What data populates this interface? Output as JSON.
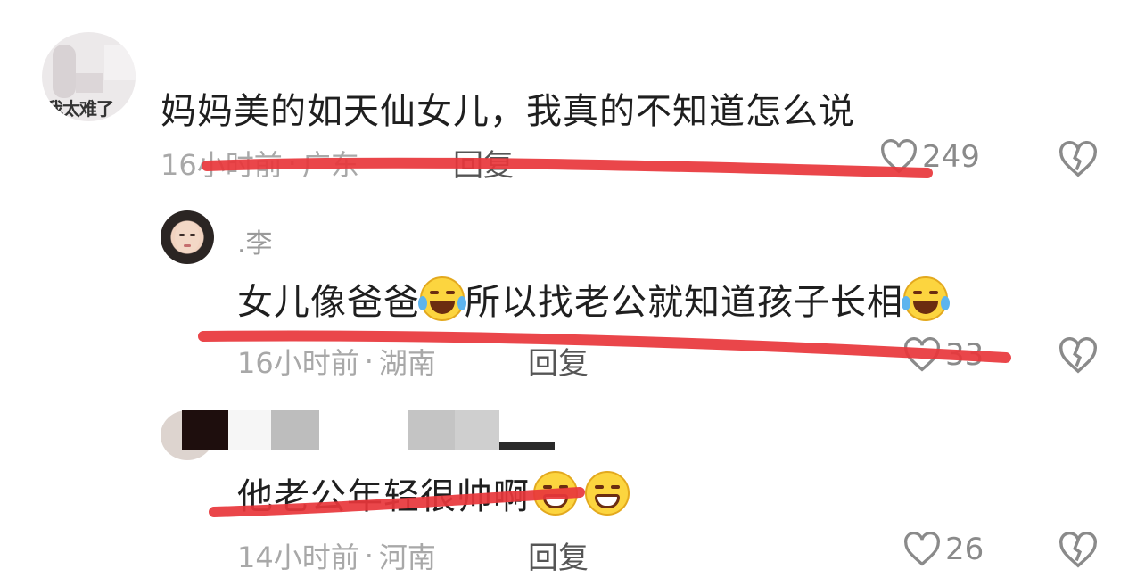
{
  "comments": [
    {
      "avatar_text": "我太难了",
      "text": "妈妈美的如天仙女儿，我真的不知道怎么说",
      "meta": {
        "time": "16小时前",
        "location": "广东",
        "reply": "回复"
      },
      "likes": "249"
    },
    {
      "username": ".李",
      "text_a": "女儿像爸爸",
      "text_b": "所以找老公就知道孩子长相",
      "meta": {
        "time": "16小时前",
        "location": "湖南",
        "reply": "回复"
      },
      "likes": "33"
    },
    {
      "text": "他老公年轻很帅啊",
      "meta": {
        "time": "14小时前",
        "location": "河南",
        "reply": "回复"
      },
      "likes": "26"
    }
  ],
  "meta_separator": "·",
  "icons": {
    "like": "heart-outline-icon",
    "dislike": "broken-heart-icon",
    "emoji_laugh": "tears-of-joy-emoji",
    "emoji_grin": "grinning-emoji"
  },
  "colors": {
    "annotation_line": "#e8363b",
    "meta_text": "#a8a8a8",
    "icon_gray": "#8a8a8a"
  }
}
